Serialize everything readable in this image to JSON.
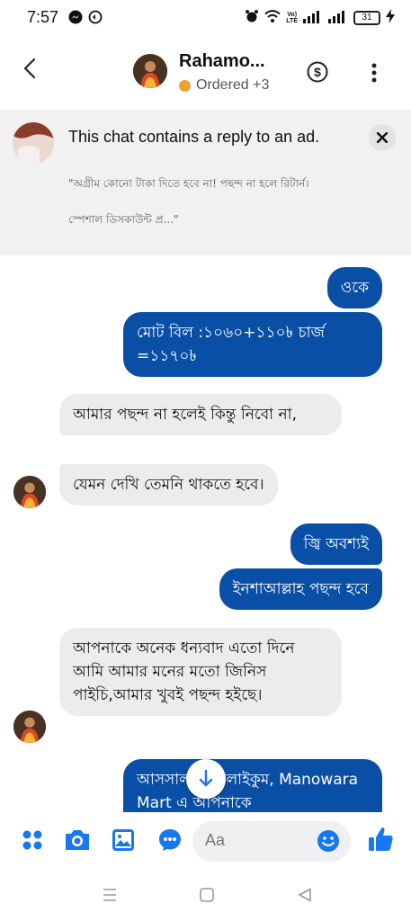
{
  "status_bar": {
    "time": "7:57",
    "volte_top": "Vo)",
    "volte_bottom": "LTE",
    "battery": "31"
  },
  "header": {
    "contact_name": "Rahamo...",
    "status_text": "Ordered +3",
    "back_icon": "back-arrow-icon",
    "payment_icon": "dollar-circle-icon",
    "menu_icon": "more-vertical-icon"
  },
  "ad_banner": {
    "title": "This chat contains a reply to an ad.",
    "body": "\"অগ্রীম কোনো টাকা দিতে হবে না!  পছন্দ না হলে রিটার্ন।\n\nস্পেশাল ডিসকাউন্ট প্র...\""
  },
  "messages": [
    {
      "id": "m1",
      "direction": "outgoing",
      "text": "ওকে"
    },
    {
      "id": "m2",
      "direction": "outgoing",
      "text": "মোট বিল :১০৬০+১১০৳ চার্জ =১১৭০৳"
    },
    {
      "id": "m3",
      "direction": "incoming",
      "text": "আমার পছন্দ না  হলেই  কিন্তু  নিবো না,"
    },
    {
      "id": "m4",
      "direction": "incoming",
      "text": "যেমন দেখি তেমনি থাকতে হবে।"
    },
    {
      "id": "m5",
      "direction": "outgoing",
      "text": "জ্বি অবশ্যই"
    },
    {
      "id": "m6",
      "direction": "outgoing",
      "text": "ইনশাআল্লাহ পছন্দ হবে"
    },
    {
      "id": "m7",
      "direction": "incoming",
      "text": "আপনাকে অনেক ধন্যবাদ এতো দিনে আমি আমার মনের মতো জিনিস পাইচি,আমার খুবই পছন্দ হইছে।"
    },
    {
      "id": "m8",
      "direction": "outgoing",
      "text": "আসসালামু আলাইকুম, Manowara Mart এ আপনাকে"
    }
  ],
  "composer": {
    "placeholder": "Aa",
    "icons": [
      "apps-grid-icon",
      "camera-icon",
      "gallery-icon",
      "chat-bubble-icon",
      "emoji-icon",
      "thumbs-up-icon"
    ]
  },
  "colors": {
    "accent": "#0a4fa6",
    "icon_blue": "#1877f2",
    "incoming_bubble": "#ececed",
    "banner_bg": "#f1f1f2",
    "status_dot": "#f0a030"
  }
}
